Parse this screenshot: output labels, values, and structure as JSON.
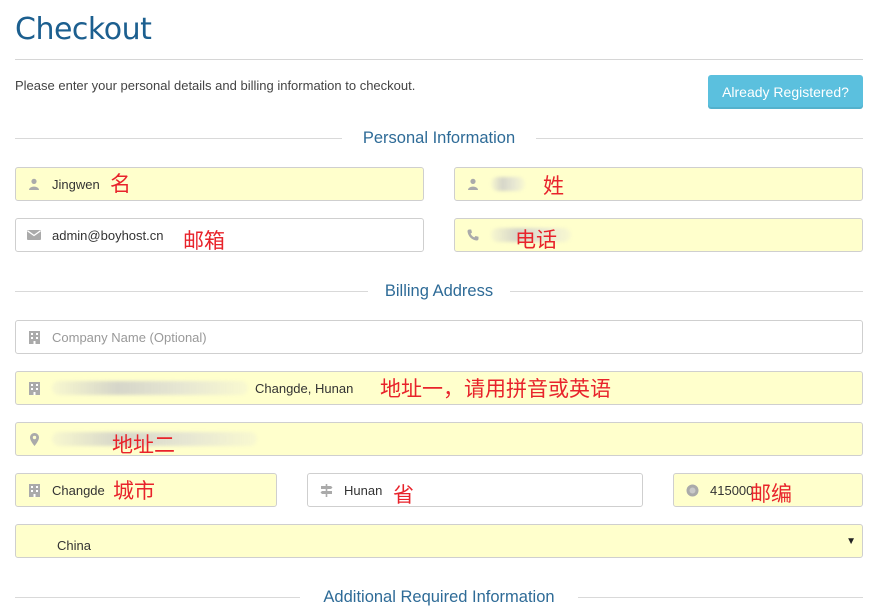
{
  "page": {
    "title": "Checkout",
    "intro": "Please enter your personal details and billing information to checkout.",
    "already_registered": "Already Registered?"
  },
  "sections": {
    "personal": "Personal Information",
    "billing": "Billing Address",
    "additional": "Additional Required Information"
  },
  "personal": {
    "first_name": {
      "value": "Jingwen",
      "note": "名",
      "icon": "user-icon"
    },
    "last_name": {
      "value": "",
      "note": "姓",
      "icon": "user-icon"
    },
    "email": {
      "value": "admin@boyhost.cn",
      "note": "邮箱",
      "icon": "envelope-icon"
    },
    "phone": {
      "value": "",
      "note": "电话",
      "icon": "phone-icon"
    }
  },
  "billing": {
    "company": {
      "placeholder": "Company Name (Optional)",
      "icon": "building-icon"
    },
    "address1": {
      "value": "Changde, Hunan",
      "note": "地址一，请用拼音或英语",
      "icon": "building-icon"
    },
    "address2": {
      "value": "",
      "note": "地址二",
      "icon": "map-marker-icon"
    },
    "city": {
      "value": "Changde",
      "note": "城市",
      "icon": "building-icon"
    },
    "state": {
      "value": "Hunan",
      "note": "省",
      "icon": "signpost-icon"
    },
    "postcode": {
      "value": "415000",
      "note": "邮编",
      "icon": "certificate-icon"
    },
    "country": {
      "value": "China",
      "icon": "caret-down-icon"
    }
  },
  "colors": {
    "title": "#1c5f8f",
    "section": "#2e6b97",
    "button": "#5bc0de",
    "autofill": "#ffffcc",
    "note": "#e8232b"
  }
}
